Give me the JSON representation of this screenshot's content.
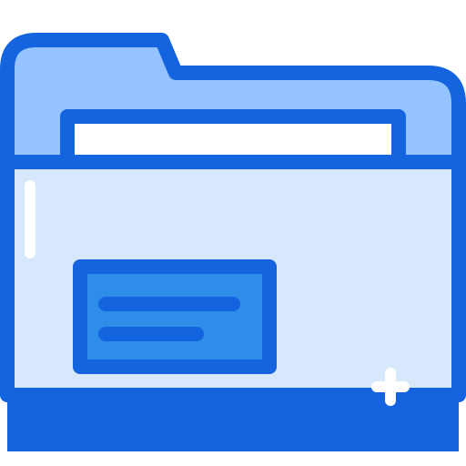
{
  "icon": {
    "name": "folder-icon",
    "parts": {
      "tab": "folder-tab-icon",
      "back_panel": "folder-back-icon",
      "paper": "paper-sheet-icon",
      "front_panel": "folder-front-icon",
      "label_card": "label-card-icon",
      "sparkle": "sparkle-icon"
    }
  },
  "colors": {
    "outline": "#1364de",
    "back_fill": "#94c3ff",
    "front_fill": "#d7e8fd",
    "paper_fill": "#ffffff",
    "label_fill": "#2d8de8",
    "highlight": "#ffffff"
  }
}
